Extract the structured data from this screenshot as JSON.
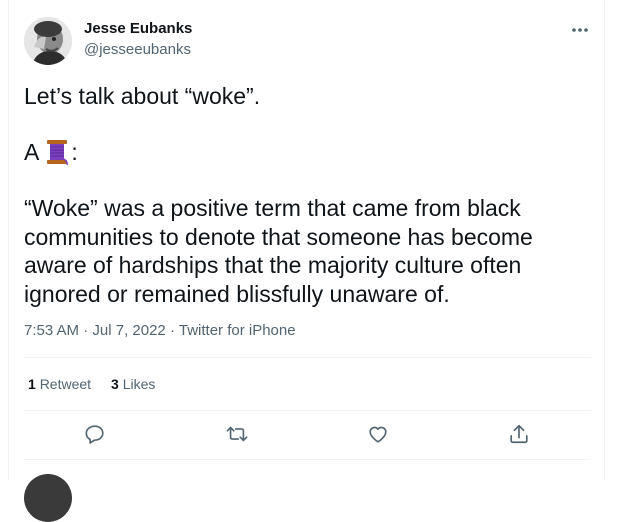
{
  "author": {
    "display_name": "Jesse Eubanks",
    "handle": "@jesseeubanks",
    "avatar_icon": "person-avatar"
  },
  "tweet": {
    "line1": "Let’s talk about “woke”.",
    "line2_prefix": "A",
    "line2_emoji_icon": "thread-spool-emoji",
    "line2_suffix": ":",
    "line3": "“Woke” was a positive term that came from black communities to denote that someone has become aware of hardships that the majority culture often ignored or remained blissfully unaware of."
  },
  "meta": {
    "time": "7:53 AM",
    "separator": "·",
    "date": "Jul 7, 2022",
    "source": "Twitter for iPhone"
  },
  "stats": {
    "retweets_count": "1",
    "retweets_label": "Retweet",
    "likes_count": "3",
    "likes_label": "Likes"
  },
  "actions": [
    "reply-icon",
    "retweet-icon",
    "like-icon",
    "share-icon"
  ],
  "colors": {
    "text": "#0f1419",
    "secondary": "#536471",
    "divider": "#eff3f4"
  }
}
